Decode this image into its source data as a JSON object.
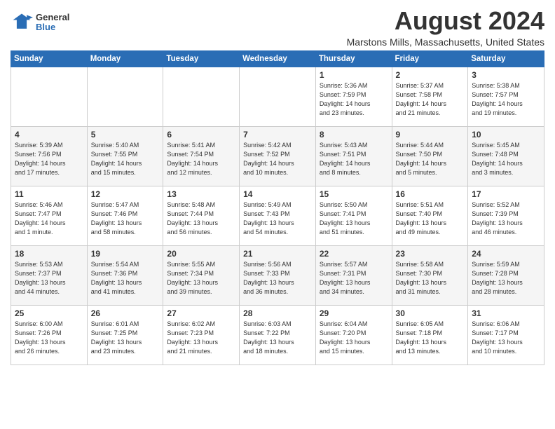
{
  "header": {
    "logo_general": "General",
    "logo_blue": "Blue",
    "month_title": "August 2024",
    "location": "Marstons Mills, Massachusetts, United States"
  },
  "weekdays": [
    "Sunday",
    "Monday",
    "Tuesday",
    "Wednesday",
    "Thursday",
    "Friday",
    "Saturday"
  ],
  "weeks": [
    [
      {
        "day": "",
        "info": ""
      },
      {
        "day": "",
        "info": ""
      },
      {
        "day": "",
        "info": ""
      },
      {
        "day": "",
        "info": ""
      },
      {
        "day": "1",
        "info": "Sunrise: 5:36 AM\nSunset: 7:59 PM\nDaylight: 14 hours\nand 23 minutes."
      },
      {
        "day": "2",
        "info": "Sunrise: 5:37 AM\nSunset: 7:58 PM\nDaylight: 14 hours\nand 21 minutes."
      },
      {
        "day": "3",
        "info": "Sunrise: 5:38 AM\nSunset: 7:57 PM\nDaylight: 14 hours\nand 19 minutes."
      }
    ],
    [
      {
        "day": "4",
        "info": "Sunrise: 5:39 AM\nSunset: 7:56 PM\nDaylight: 14 hours\nand 17 minutes."
      },
      {
        "day": "5",
        "info": "Sunrise: 5:40 AM\nSunset: 7:55 PM\nDaylight: 14 hours\nand 15 minutes."
      },
      {
        "day": "6",
        "info": "Sunrise: 5:41 AM\nSunset: 7:54 PM\nDaylight: 14 hours\nand 12 minutes."
      },
      {
        "day": "7",
        "info": "Sunrise: 5:42 AM\nSunset: 7:52 PM\nDaylight: 14 hours\nand 10 minutes."
      },
      {
        "day": "8",
        "info": "Sunrise: 5:43 AM\nSunset: 7:51 PM\nDaylight: 14 hours\nand 8 minutes."
      },
      {
        "day": "9",
        "info": "Sunrise: 5:44 AM\nSunset: 7:50 PM\nDaylight: 14 hours\nand 5 minutes."
      },
      {
        "day": "10",
        "info": "Sunrise: 5:45 AM\nSunset: 7:48 PM\nDaylight: 14 hours\nand 3 minutes."
      }
    ],
    [
      {
        "day": "11",
        "info": "Sunrise: 5:46 AM\nSunset: 7:47 PM\nDaylight: 14 hours\nand 1 minute."
      },
      {
        "day": "12",
        "info": "Sunrise: 5:47 AM\nSunset: 7:46 PM\nDaylight: 13 hours\nand 58 minutes."
      },
      {
        "day": "13",
        "info": "Sunrise: 5:48 AM\nSunset: 7:44 PM\nDaylight: 13 hours\nand 56 minutes."
      },
      {
        "day": "14",
        "info": "Sunrise: 5:49 AM\nSunset: 7:43 PM\nDaylight: 13 hours\nand 54 minutes."
      },
      {
        "day": "15",
        "info": "Sunrise: 5:50 AM\nSunset: 7:41 PM\nDaylight: 13 hours\nand 51 minutes."
      },
      {
        "day": "16",
        "info": "Sunrise: 5:51 AM\nSunset: 7:40 PM\nDaylight: 13 hours\nand 49 minutes."
      },
      {
        "day": "17",
        "info": "Sunrise: 5:52 AM\nSunset: 7:39 PM\nDaylight: 13 hours\nand 46 minutes."
      }
    ],
    [
      {
        "day": "18",
        "info": "Sunrise: 5:53 AM\nSunset: 7:37 PM\nDaylight: 13 hours\nand 44 minutes."
      },
      {
        "day": "19",
        "info": "Sunrise: 5:54 AM\nSunset: 7:36 PM\nDaylight: 13 hours\nand 41 minutes."
      },
      {
        "day": "20",
        "info": "Sunrise: 5:55 AM\nSunset: 7:34 PM\nDaylight: 13 hours\nand 39 minutes."
      },
      {
        "day": "21",
        "info": "Sunrise: 5:56 AM\nSunset: 7:33 PM\nDaylight: 13 hours\nand 36 minutes."
      },
      {
        "day": "22",
        "info": "Sunrise: 5:57 AM\nSunset: 7:31 PM\nDaylight: 13 hours\nand 34 minutes."
      },
      {
        "day": "23",
        "info": "Sunrise: 5:58 AM\nSunset: 7:30 PM\nDaylight: 13 hours\nand 31 minutes."
      },
      {
        "day": "24",
        "info": "Sunrise: 5:59 AM\nSunset: 7:28 PM\nDaylight: 13 hours\nand 28 minutes."
      }
    ],
    [
      {
        "day": "25",
        "info": "Sunrise: 6:00 AM\nSunset: 7:26 PM\nDaylight: 13 hours\nand 26 minutes."
      },
      {
        "day": "26",
        "info": "Sunrise: 6:01 AM\nSunset: 7:25 PM\nDaylight: 13 hours\nand 23 minutes."
      },
      {
        "day": "27",
        "info": "Sunrise: 6:02 AM\nSunset: 7:23 PM\nDaylight: 13 hours\nand 21 minutes."
      },
      {
        "day": "28",
        "info": "Sunrise: 6:03 AM\nSunset: 7:22 PM\nDaylight: 13 hours\nand 18 minutes."
      },
      {
        "day": "29",
        "info": "Sunrise: 6:04 AM\nSunset: 7:20 PM\nDaylight: 13 hours\nand 15 minutes."
      },
      {
        "day": "30",
        "info": "Sunrise: 6:05 AM\nSunset: 7:18 PM\nDaylight: 13 hours\nand 13 minutes."
      },
      {
        "day": "31",
        "info": "Sunrise: 6:06 AM\nSunset: 7:17 PM\nDaylight: 13 hours\nand 10 minutes."
      }
    ]
  ]
}
